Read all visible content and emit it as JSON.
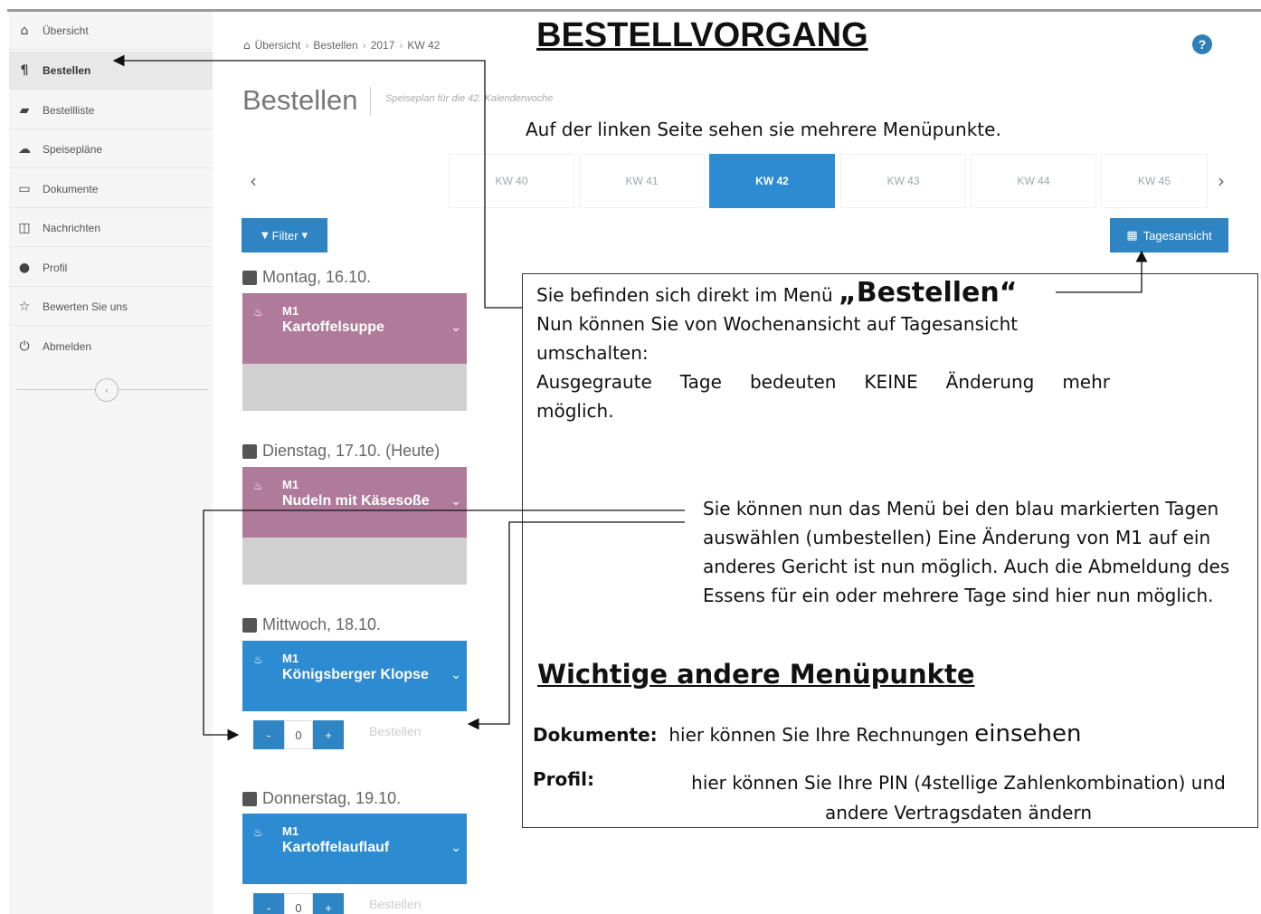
{
  "sidebar": {
    "items": [
      {
        "label": "Übersicht",
        "icon": "home-icon",
        "glyph": "⌂"
      },
      {
        "label": "Bestellen",
        "icon": "cutlery-icon",
        "glyph": "¶"
      },
      {
        "label": "Bestellliste",
        "icon": "book-icon",
        "glyph": "▰"
      },
      {
        "label": "Speisepläne",
        "icon": "cloud-icon",
        "glyph": "☁"
      },
      {
        "label": "Dokumente",
        "icon": "document-icon",
        "glyph": "▭"
      },
      {
        "label": "Nachrichten",
        "icon": "inbox-icon",
        "glyph": "◫"
      },
      {
        "label": "Profil",
        "icon": "user-icon",
        "glyph": "●"
      },
      {
        "label": "Bewerten Sie uns",
        "icon": "star-icon",
        "glyph": "☆"
      },
      {
        "label": "Abmelden",
        "icon": "power-icon",
        "glyph": "⏻"
      }
    ],
    "collapse_glyph": "‹"
  },
  "breadcrumb": {
    "items": [
      "Übersicht",
      "Bestellen",
      "2017",
      "KW 42"
    ],
    "separator": "›",
    "home_glyph": "⌂"
  },
  "page": {
    "title": "Bestellen",
    "subtitle": "Speiseplan für die 42. Kalenderwoche",
    "help_glyph": "?"
  },
  "weeks": {
    "prev_glyph": "‹",
    "next_glyph": "›",
    "tabs": [
      "KW 40",
      "KW 41",
      "KW 42",
      "KW 43",
      "KW 44",
      "KW 45"
    ],
    "active": "KW 42"
  },
  "filter": {
    "label": "Filter",
    "glyph": "▼",
    "caret": "▾"
  },
  "day_view": {
    "label": "Tagesansicht",
    "glyph": "▦"
  },
  "days": [
    {
      "header": "Montag, 16.10.",
      "code": "M1",
      "dish": "Kartoffelsuppe",
      "state": "locked"
    },
    {
      "header": "Dienstag, 17.10. (Heute)",
      "code": "M1",
      "dish": "Nudeln mit Käsesoße",
      "state": "locked"
    },
    {
      "header": "Mittwoch, 18.10.",
      "code": "M1",
      "dish": "Königsberger Klopse",
      "state": "open",
      "quantity": "0",
      "order_label": "Bestellen"
    },
    {
      "header": "Donnerstag, 19.10.",
      "code": "M1",
      "dish": "Kartoffelauflauf",
      "state": "open",
      "quantity": "0",
      "order_label": "Bestellen"
    }
  ],
  "meal": {
    "bowl_glyph": "♨",
    "chevron_glyph": "⌄",
    "minus": "-",
    "plus": "+"
  },
  "annotations": {
    "title": "BESTELLVORGANG",
    "left_menu_note": "Auf der linken Seite sehen sie mehrere Menüpunkte.",
    "box_line1_prefix": "Sie befinden sich direkt im Menü ",
    "box_line1_big": "„Bestellen“",
    "box_line2": "Nun können Sie von Wochenansicht auf Tagesansicht umschalten:",
    "box_line3": "Ausgegraute Tage bedeuten KEINE Änderung mehr",
    "box_line4": "möglich.",
    "blue_days_note": "Sie können nun das Menü bei den blau markierten Tagen auswählen (umbestellen) Eine Änderung von M1 auf ein anderes Gericht ist nun möglich. Auch die Abmeldung des Essens für ein oder mehrere Tage sind hier nun möglich.",
    "section_heading": "Wichtige andere Menüpunkte",
    "doc_label": "Dokumente:",
    "doc_text_prefix": "hier können Sie Ihre Rechnungen ",
    "doc_text_big": "einsehen",
    "profil_label": "Profil:",
    "profil_text": "hier können Sie Ihre PIN (4stellige Zahlenkombination) und andere Vertragsdaten ändern"
  },
  "colors": {
    "primary_blue": "#2d8bd1",
    "locked_pink": "#b07a9a",
    "locked_grey": "#d0d0d0",
    "sidebar_bg": "#f5f5f5"
  }
}
